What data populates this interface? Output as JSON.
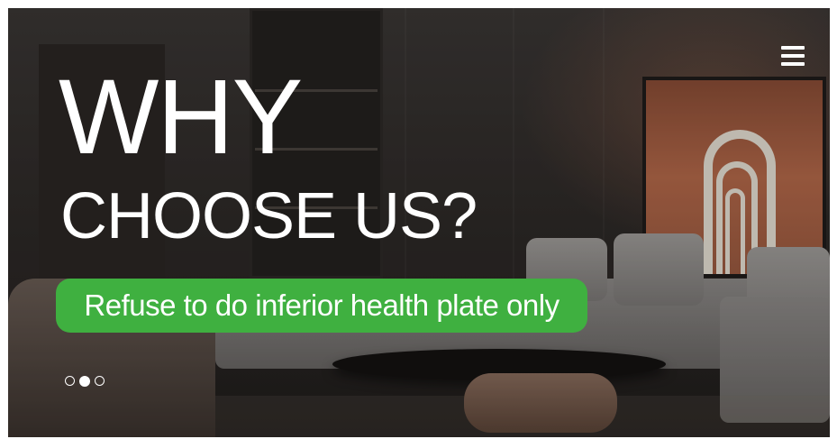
{
  "hero": {
    "title_line1": "WHY",
    "title_line2": "CHOOSE US?",
    "tagline": "Refuse to do inferior health plate only",
    "tagline_color": "#3fb040"
  },
  "carousel": {
    "slides": 3,
    "active_index": 1
  },
  "icons": {
    "menu": "hamburger-menu-icon"
  }
}
